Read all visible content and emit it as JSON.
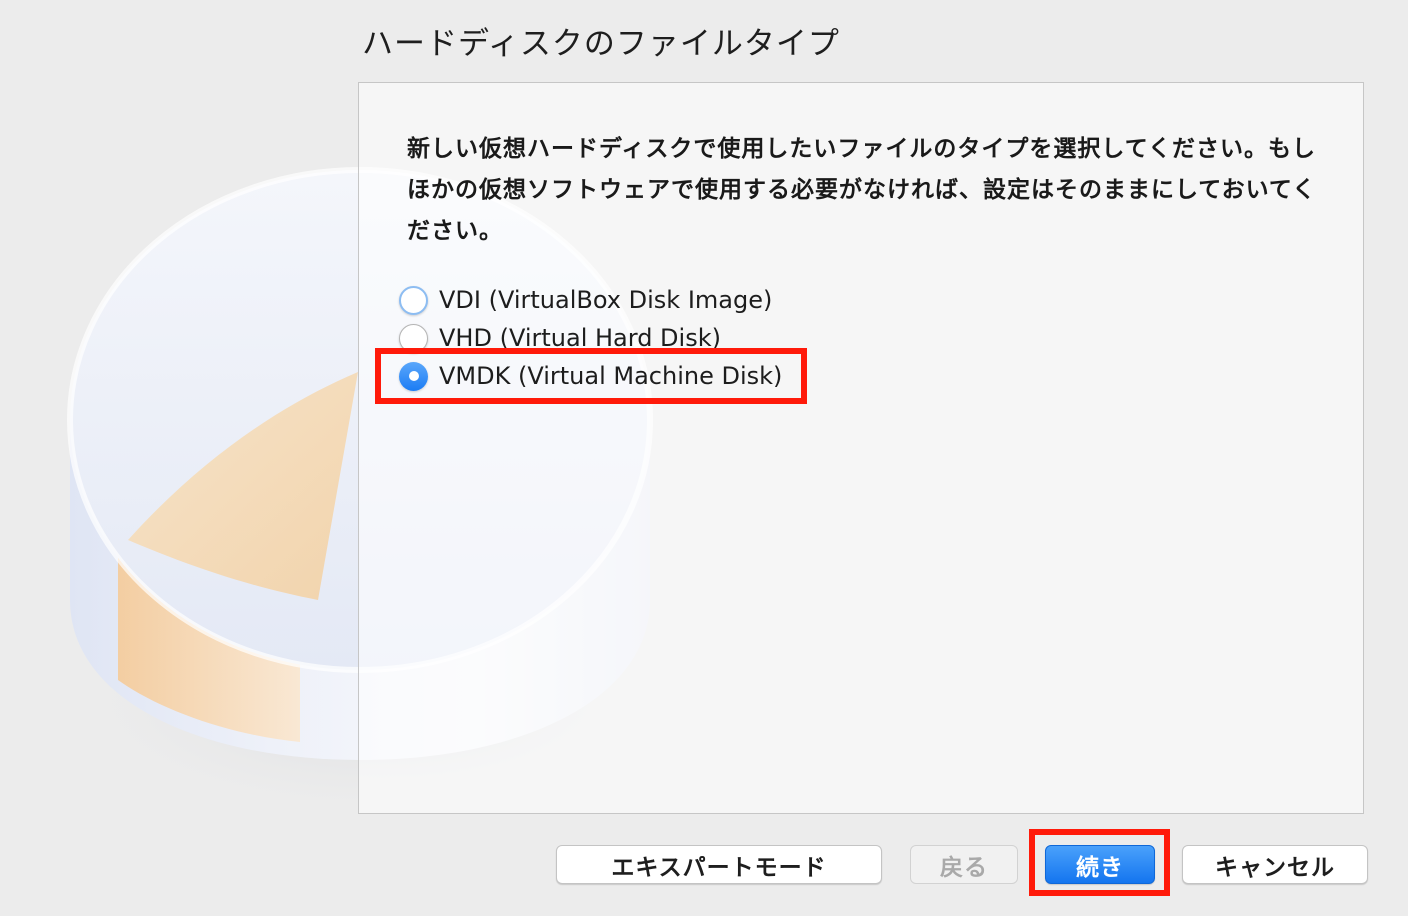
{
  "window": {
    "title": "ハードディスクのファイルタイプ"
  },
  "main": {
    "description": "新しい仮想ハードディスクで使用したいファイルのタイプを選択してください。もしほかの仮想ソフトウェアで使用する必要がなければ、設定はそのままにしておいてください。",
    "options": [
      {
        "label": "VDI (VirtualBox Disk Image)",
        "selected": false
      },
      {
        "label": "VHD (Virtual Hard Disk)",
        "selected": false
      },
      {
        "label": "VMDK (Virtual Machine Disk)",
        "selected": true
      }
    ]
  },
  "buttons": {
    "expert_mode": "エキスパートモード",
    "back": "戻る",
    "continue": "続き",
    "cancel": "キャンセル"
  },
  "colors": {
    "accent": "#1b7cf4",
    "highlight": "#ff1a0a",
    "background": "#ececec"
  },
  "icons": {
    "illustration": "hard-disk-icon"
  }
}
